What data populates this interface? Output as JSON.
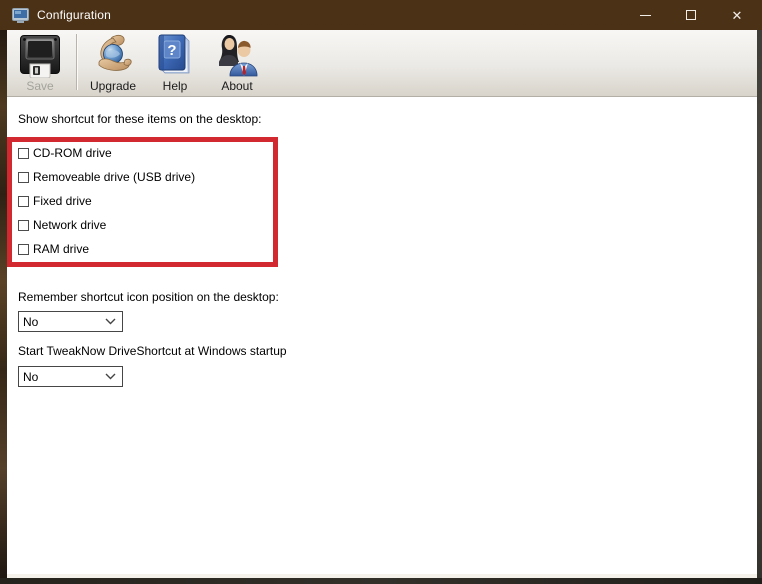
{
  "window": {
    "title": "Configuration",
    "controls": {
      "minimize_label": "minimize",
      "maximize_label": "maximize",
      "close_glyph": "✕"
    }
  },
  "toolbar": {
    "buttons": [
      {
        "label": "Save",
        "icon": "floppy-disk-icon",
        "enabled": false
      },
      {
        "label": "Upgrade",
        "icon": "hands-globe-icon",
        "enabled": true
      },
      {
        "label": "Help",
        "icon": "book-question-icon",
        "enabled": true
      },
      {
        "label": "About",
        "icon": "people-icon",
        "enabled": true
      }
    ]
  },
  "content": {
    "shortcut_section": {
      "label": "Show shortcut for these items on the desktop:",
      "checkboxes": [
        {
          "label": "CD-ROM drive",
          "checked": false
        },
        {
          "label": "Removeable drive (USB drive)",
          "checked": false
        },
        {
          "label": "Fixed drive",
          "checked": false
        },
        {
          "label": "Network drive",
          "checked": false
        },
        {
          "label": "RAM drive",
          "checked": false
        }
      ],
      "annotation_color": "#d2282f"
    },
    "remember_section": {
      "label": "Remember shortcut icon position on the desktop:",
      "value": "No"
    },
    "startup_section": {
      "label": "Start TweakNow DriveShortcut at Windows startup",
      "value": "No"
    }
  },
  "colors": {
    "titlebar": "#4b3116",
    "annotation": "#d2282f",
    "toolbar_top": "#f8f7f5",
    "toolbar_bottom": "#d8d4cb"
  }
}
